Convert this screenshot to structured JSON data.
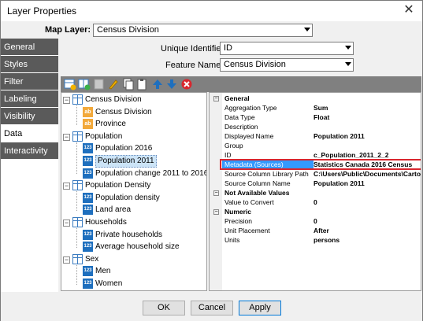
{
  "window": {
    "title": "Layer Properties",
    "close": "✕"
  },
  "map_layer": {
    "label": "Map Layer:",
    "value": "Census Division"
  },
  "sidebar": {
    "items": [
      {
        "label": "General",
        "active": false
      },
      {
        "label": "Styles",
        "active": false
      },
      {
        "label": "Filter",
        "active": false
      },
      {
        "label": "Labeling",
        "active": false
      },
      {
        "label": "Visibility Ranges",
        "active": false
      },
      {
        "label": "Data",
        "active": true
      },
      {
        "label": "Interactivity",
        "active": false
      }
    ]
  },
  "identifiers": {
    "unique_label": "Unique Identifier:",
    "unique_value": "ID",
    "feature_label": "Feature Name:",
    "feature_value": "Census Division"
  },
  "toolbar": {
    "icons": [
      "add-table-icon",
      "add-column-icon",
      "delete-icon",
      "edit-icon",
      "copy-icon",
      "paste-icon",
      "move-up-icon",
      "move-down-icon",
      "remove-icon"
    ]
  },
  "tree": {
    "groups": [
      {
        "label": "Census Division",
        "children": [
          {
            "label": "Census Division",
            "type": "text"
          },
          {
            "label": "Province",
            "type": "text"
          }
        ]
      },
      {
        "label": "Population",
        "children": [
          {
            "label": "Population 2016",
            "type": "number"
          },
          {
            "label": "Population 2011",
            "type": "number",
            "selected": true
          },
          {
            "label": "Population change 2011 to 2016",
            "type": "number"
          }
        ]
      },
      {
        "label": "Population Density",
        "children": [
          {
            "label": "Population density",
            "type": "number"
          },
          {
            "label": "Land area",
            "type": "number"
          }
        ]
      },
      {
        "label": "Households",
        "children": [
          {
            "label": "Private households",
            "type": "number"
          },
          {
            "label": "Average household size",
            "type": "number"
          }
        ]
      },
      {
        "label": "Sex",
        "children": [
          {
            "label": "Men",
            "type": "number"
          },
          {
            "label": "Women",
            "type": "number"
          }
        ]
      }
    ],
    "icon_text": {
      "ab": "ab",
      "num": "123"
    }
  },
  "properties": {
    "sections": [
      {
        "name": "General",
        "rows": [
          {
            "name": "Aggregation Type",
            "value": "Sum"
          },
          {
            "name": "Data Type",
            "value": "Float"
          },
          {
            "name": "Description",
            "value": ""
          },
          {
            "name": "Displayed Name",
            "value": "Population 2011"
          },
          {
            "name": "Group",
            "value": ""
          },
          {
            "name": "ID",
            "value": "c_Population_2011_2_2"
          },
          {
            "name": "Metadata (Sources)",
            "value": "Statistics Canada 2016 Census",
            "highlight": true
          },
          {
            "name": "Source Column Library Path",
            "value": "C:\\Users\\Public\\Documents\\CartoVista"
          },
          {
            "name": "Source Column Name",
            "value": "Population 2011"
          }
        ]
      },
      {
        "name": "Not Available Values",
        "rows": [
          {
            "name": "Value to Convert",
            "value": "0"
          }
        ]
      },
      {
        "name": "Numeric",
        "rows": [
          {
            "name": "Precision",
            "value": "0"
          },
          {
            "name": "Unit Placement",
            "value": "After"
          },
          {
            "name": "Units",
            "value": "persons"
          }
        ]
      }
    ],
    "collapse_glyph": "−"
  },
  "buttons": {
    "ok": "OK",
    "cancel": "Cancel",
    "apply": "Apply"
  },
  "colors": {
    "sidebar_bg": "#5a5a5a",
    "highlight_border": "#d9262e",
    "selection": "#3399ff",
    "toolbar_bg": "#808080"
  }
}
